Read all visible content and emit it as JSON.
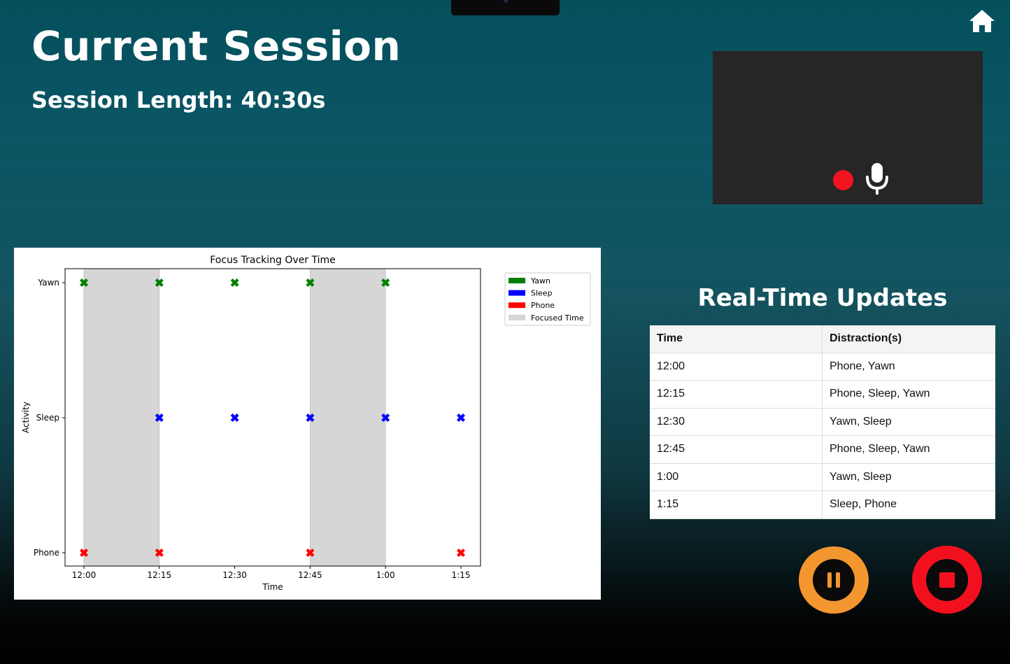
{
  "header": {
    "title": "Current Session",
    "session_length_label": "Session Length:",
    "session_length_value": "40:30s",
    "home_icon": "home-icon"
  },
  "video_preview": {
    "recording_indicator": "record-dot-icon",
    "microphone_icon": "microphone-icon",
    "colors": {
      "panel": "#272525",
      "record": "#f0141e",
      "mic": "#ffffff"
    }
  },
  "chart_data": {
    "type": "scatter",
    "title": "Focus Tracking Over Time",
    "xlabel": "Time",
    "ylabel": "Activity",
    "x_categories": [
      "12:00",
      "12:15",
      "12:30",
      "12:45",
      "1:00",
      "1:15"
    ],
    "y_categories": [
      "Phone",
      "Sleep",
      "Yawn"
    ],
    "marker": "X",
    "series": [
      {
        "name": "Yawn",
        "color": "#008000",
        "points": [
          "12:00",
          "12:15",
          "12:30",
          "12:45",
          "1:00"
        ]
      },
      {
        "name": "Sleep",
        "color": "#0000ff",
        "points": [
          "12:15",
          "12:30",
          "12:45",
          "1:00",
          "1:15"
        ]
      },
      {
        "name": "Phone",
        "color": "#ff0000",
        "points": [
          "12:00",
          "12:15",
          "12:45",
          "1:15"
        ]
      }
    ],
    "focused_time": {
      "name": "Focused Time",
      "color": "#d6d6d6",
      "ranges": [
        [
          "12:00",
          "12:15"
        ],
        [
          "12:45",
          "1:00"
        ]
      ]
    },
    "legend_position": "upper right, outside plot"
  },
  "updates": {
    "title": "Real-Time Updates",
    "columns": [
      "Time",
      "Distraction(s)"
    ],
    "rows": [
      [
        "12:00",
        "Phone, Yawn"
      ],
      [
        "12:15",
        "Phone, Sleep, Yawn"
      ],
      [
        "12:30",
        "Yawn, Sleep"
      ],
      [
        "12:45",
        "Phone, Sleep, Yawn"
      ],
      [
        "1:00",
        "Yawn, Sleep"
      ],
      [
        "1:15",
        "Sleep, Phone"
      ]
    ]
  },
  "controls": {
    "pause_icon": "pause-icon",
    "stop_icon": "stop-icon",
    "pause_color": "#f3962f",
    "stop_color": "#f3101e"
  }
}
